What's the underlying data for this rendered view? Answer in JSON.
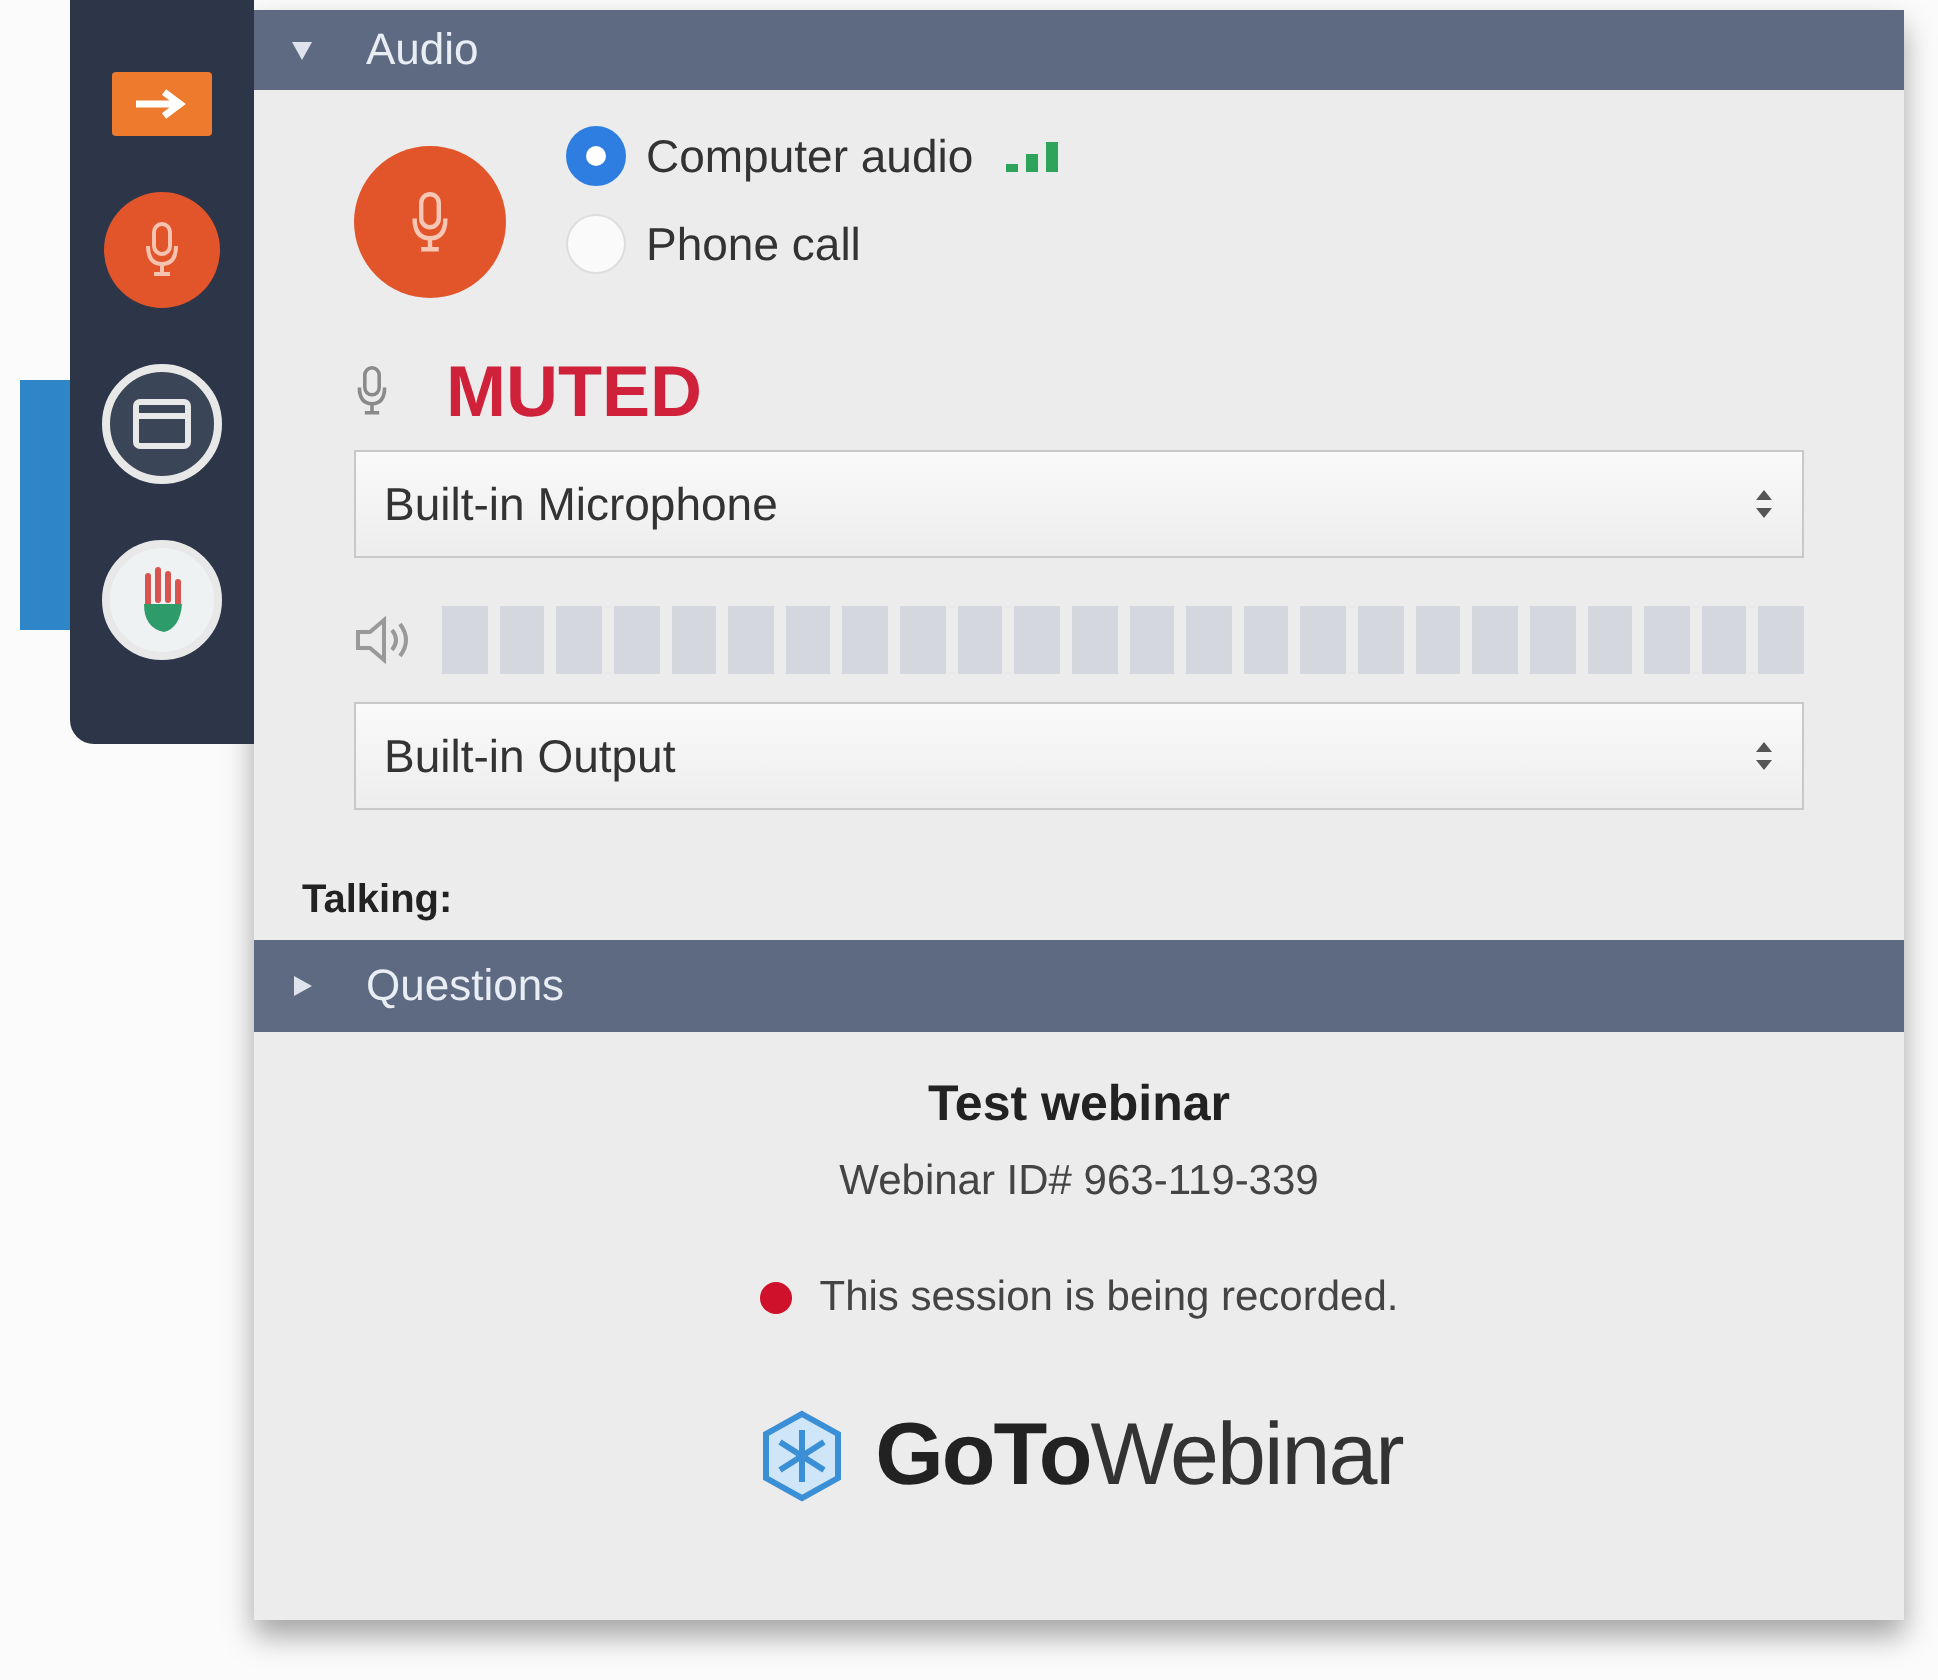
{
  "toolbar": {
    "items": [
      {
        "kind": "collapse"
      },
      {
        "kind": "mic"
      },
      {
        "kind": "screen"
      },
      {
        "kind": "hand"
      }
    ]
  },
  "audio_section": {
    "title": "Audio",
    "expanded": true,
    "mic_muted": true,
    "options": [
      {
        "label": "Computer audio",
        "selected": true
      },
      {
        "label": "Phone call",
        "selected": false
      }
    ],
    "mic_status": "MUTED",
    "microphone": {
      "value": "Built-in Microphone"
    },
    "speaker": {
      "value": "Built-in Output"
    },
    "talking_label": "Talking:"
  },
  "questions_section": {
    "title": "Questions",
    "expanded": false
  },
  "session": {
    "title": "Test webinar",
    "id": "Webinar ID# 963-119-339",
    "recording": {
      "text": "This session is being recorded.",
      "color": "#d0112b"
    },
    "logo": "**GoTo**Webinar"
  }
}
